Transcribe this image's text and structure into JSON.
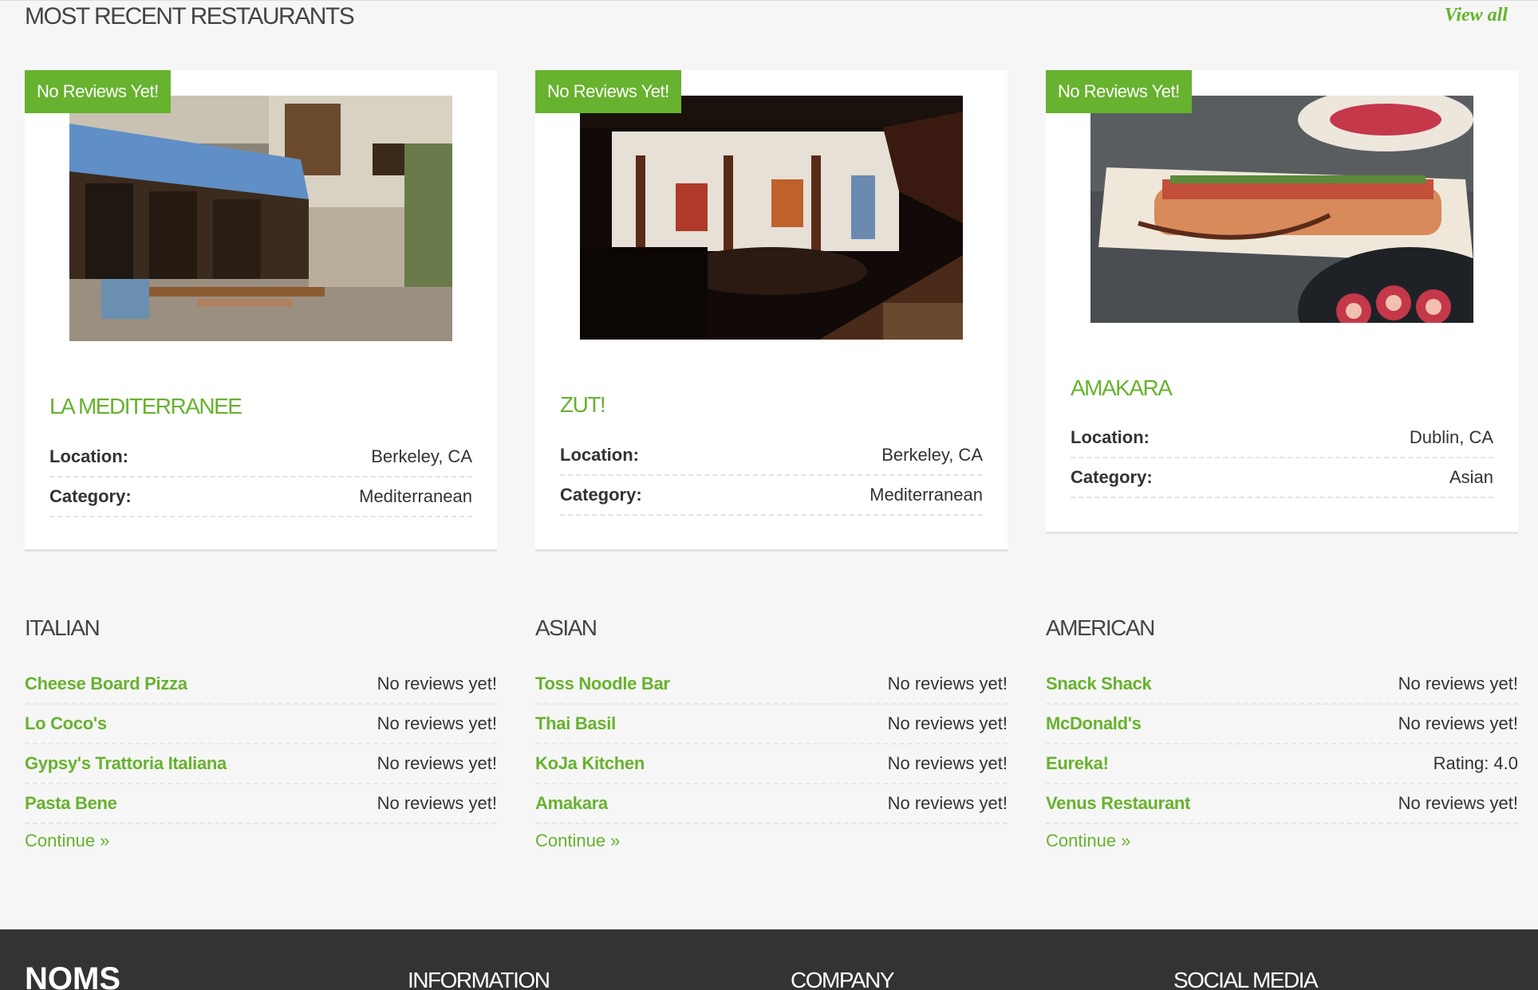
{
  "recent": {
    "title": "MOST RECENT RESTAURANTS",
    "view_all": "View all",
    "cards": [
      {
        "badge": "No Reviews Yet!",
        "name": "LA MEDITERRANEE",
        "location_label": "Location:",
        "location": "Berkeley, CA",
        "category_label": "Category:",
        "category": "Mediterranean"
      },
      {
        "badge": "No Reviews Yet!",
        "name": "ZUT!",
        "location_label": "Location:",
        "location": "Berkeley, CA",
        "category_label": "Category:",
        "category": "Mediterranean"
      },
      {
        "badge": "No Reviews Yet!",
        "name": "AMAKARA",
        "location_label": "Location:",
        "location": "Dublin, CA",
        "category_label": "Category:",
        "category": "Asian"
      }
    ]
  },
  "categories": [
    {
      "title": "ITALIAN",
      "items": [
        {
          "name": "Cheese Board Pizza",
          "status": "No reviews yet!"
        },
        {
          "name": "Lo Coco's",
          "status": "No reviews yet!"
        },
        {
          "name": "Gypsy's Trattoria Italiana",
          "status": "No reviews yet!"
        },
        {
          "name": "Pasta Bene",
          "status": "No reviews yet!"
        }
      ],
      "continue": "Continue »"
    },
    {
      "title": "ASIAN",
      "items": [
        {
          "name": "Toss Noodle Bar",
          "status": "No reviews yet!"
        },
        {
          "name": "Thai Basil",
          "status": "No reviews yet!"
        },
        {
          "name": "KoJa Kitchen",
          "status": "No reviews yet!"
        },
        {
          "name": "Amakara",
          "status": "No reviews yet!"
        }
      ],
      "continue": "Continue »"
    },
    {
      "title": "AMERICAN",
      "items": [
        {
          "name": "Snack Shack",
          "status": "No reviews yet!"
        },
        {
          "name": "McDonald's",
          "status": "No reviews yet!"
        },
        {
          "name": "Eureka!",
          "status": "Rating: 4.0"
        },
        {
          "name": "Venus Restaurant",
          "status": "No reviews yet!"
        }
      ],
      "continue": "Continue »"
    }
  ],
  "footer": {
    "logo": "NOMS",
    "columns": [
      "INFORMATION",
      "COMPANY",
      "SOCIAL MEDIA"
    ]
  },
  "colors": {
    "accent": "#67b22e",
    "footer_bg": "#333333",
    "page_bg": "#f6f6f6"
  }
}
